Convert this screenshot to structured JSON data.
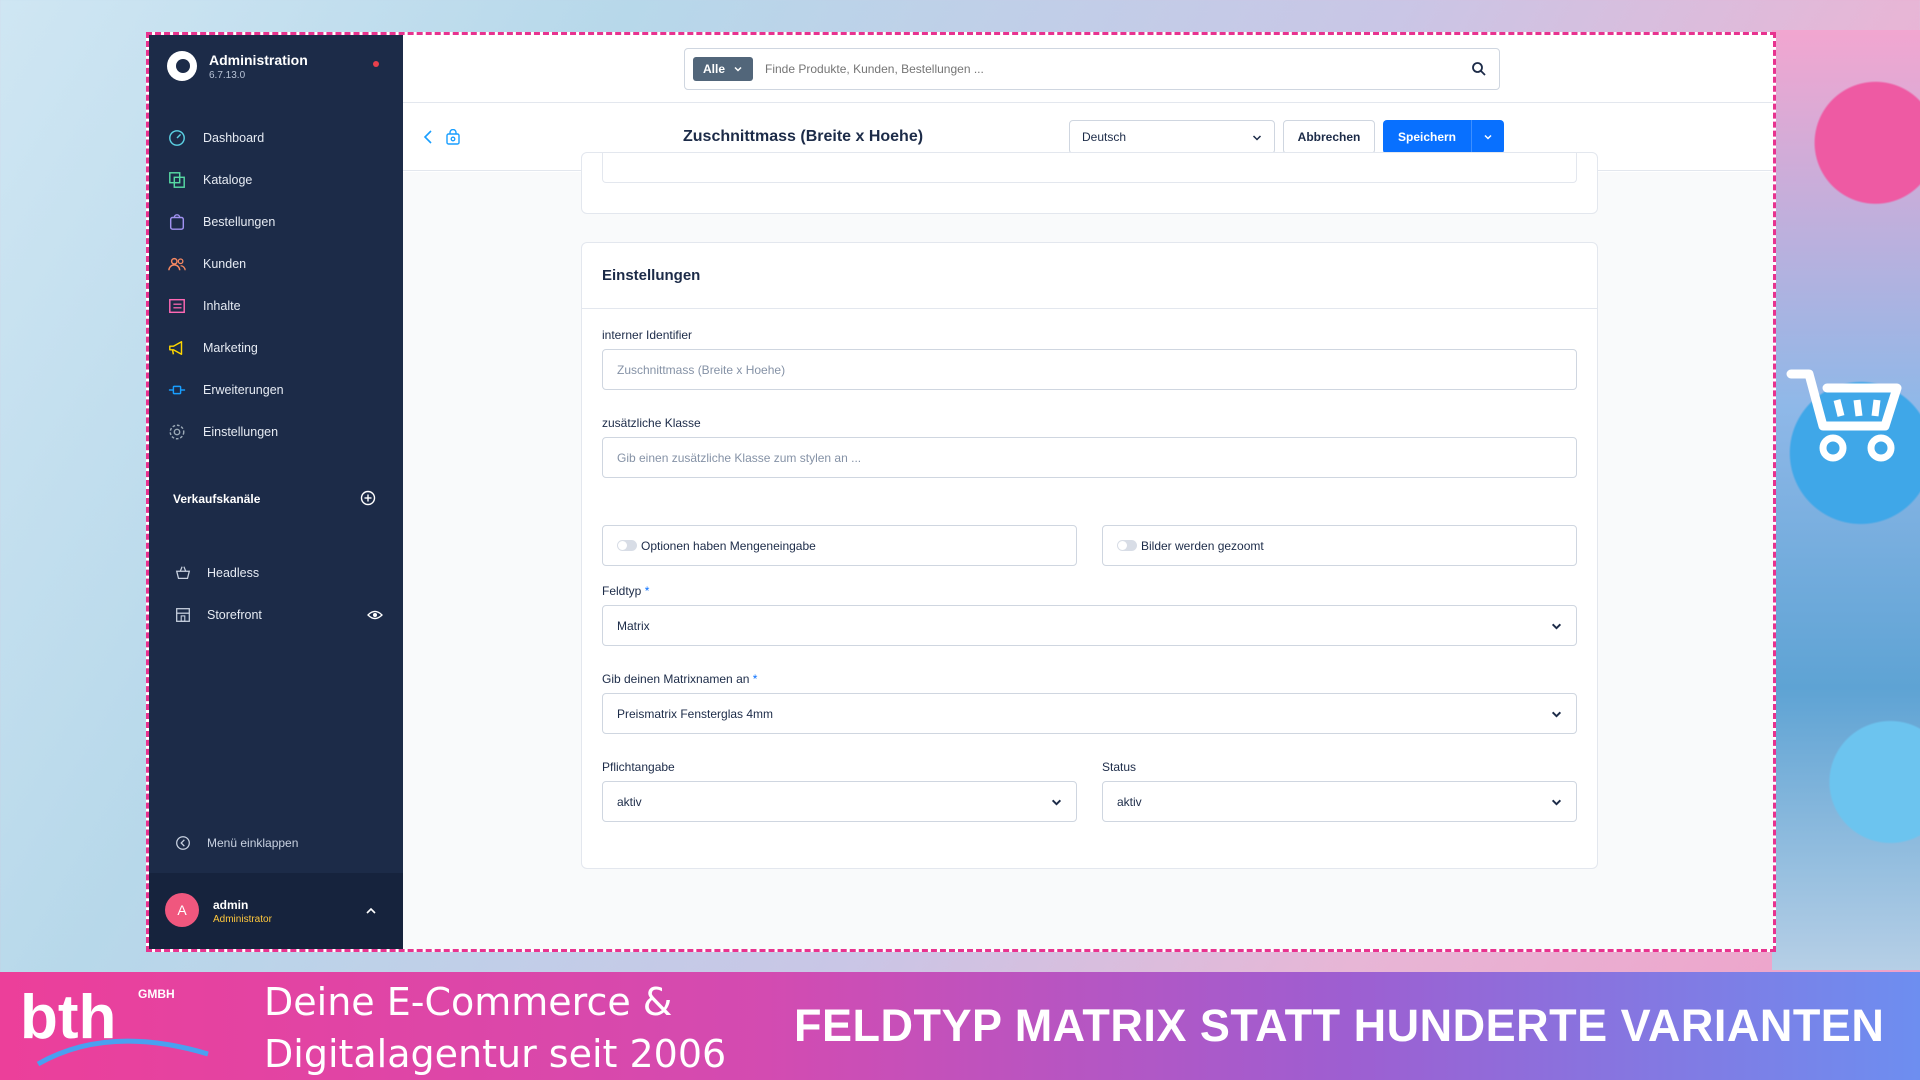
{
  "app": {
    "title": "Administration",
    "version": "6.7.13.0"
  },
  "sidebar": {
    "items": [
      {
        "label": "Dashboard",
        "icon": "gauge-icon",
        "color": "#5bd1e3"
      },
      {
        "label": "Kataloge",
        "icon": "catalog-icon",
        "color": "#57d9a3"
      },
      {
        "label": "Bestellungen",
        "icon": "shopping-bag-icon",
        "color": "#a092f0"
      },
      {
        "label": "Kunden",
        "icon": "users-icon",
        "color": "#f88962"
      },
      {
        "label": "Inhalte",
        "icon": "content-icon",
        "color": "#ff68b4"
      },
      {
        "label": "Marketing",
        "icon": "megaphone-icon",
        "color": "#ffd700"
      },
      {
        "label": "Erweiterungen",
        "icon": "plug-icon",
        "color": "#189eff"
      },
      {
        "label": "Einstellungen",
        "icon": "gear-icon",
        "color": "#9aa8b5"
      }
    ],
    "channels_title": "Verkaufskanäle",
    "channels": [
      {
        "label": "Headless",
        "icon": "basket-icon"
      },
      {
        "label": "Storefront",
        "icon": "storefront-icon"
      }
    ],
    "collapse_label": "Menü einklappen",
    "user": {
      "initial": "A",
      "name": "admin",
      "role": "Administrator"
    }
  },
  "topbar": {
    "search_scope": "Alle",
    "search_placeholder": "Finde Produkte, Kunden, Bestellungen ..."
  },
  "smartbar": {
    "title": "Zuschnittmass (Breite x Hoehe)",
    "language": "Deutsch",
    "cancel_label": "Abbrechen",
    "save_label": "Speichern"
  },
  "settings": {
    "title": "Einstellungen",
    "identifier": {
      "label": "interner Identifier",
      "placeholder": "Zuschnittmass (Breite x Hoehe)"
    },
    "css_class": {
      "label": "zusätzliche Klasse",
      "placeholder": "Gib einen zusätzliche Klasse zum stylen an ..."
    },
    "toggle_quantity": {
      "label": "Optionen haben Mengeneingabe",
      "checked": false
    },
    "toggle_zoom": {
      "label": "Bilder werden gezoomt",
      "checked": false
    },
    "field_type": {
      "label": "Feldtyp",
      "required_mark": "*",
      "value": "Matrix"
    },
    "matrix_name": {
      "label": "Gib deinen Matrixnamen an",
      "required_mark": "*",
      "value": "Preismatrix Fensterglas 4mm"
    },
    "required": {
      "label": "Pflichtangabe",
      "value": "aktiv"
    },
    "status": {
      "label": "Status",
      "value": "aktiv"
    }
  },
  "banner": {
    "logo_text": "bth GMBH",
    "tagline": "Deine E-Commerce & Digitalagentur seit 2006",
    "headline": "FELDTYP MATRIX STATT HUNDERTE VARIANTEN"
  },
  "colors": {
    "sidebar_bg": "#1c2b48",
    "primary": "#0870ff",
    "frame_border": "#e8338f"
  }
}
